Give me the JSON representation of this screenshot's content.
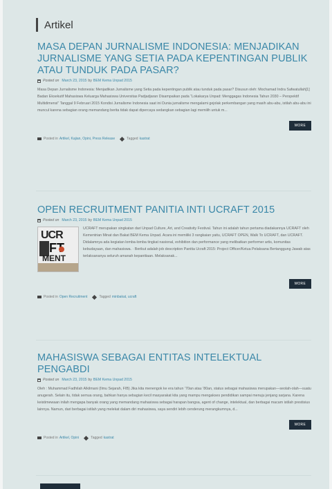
{
  "section": {
    "title": "Artikel"
  },
  "labels": {
    "posted_on": "Posted on",
    "by": "by",
    "posted_in": "Posted in",
    "tagged": "Tagged",
    "more": "MORE"
  },
  "posts": [
    {
      "title": "MASA DEPAN JURNALISME INDONESIA: MENJADIKAN JURNALISME YANG SETIA PADA KEPENTINGAN PUBLIK ATAU TUNDUK PADA PASAR?",
      "date": "March 23, 2015",
      "author": "BEM Kema Unpad 2015",
      "excerpt": "Masa Depan Jurnalisme Indonesia: Menjadikan Jurnalisme yang Setia pada kepentingan publik atau tunduk pada pasar? Disusun oleh: Mochamad Indra Safwatullah[1] Badan Eksekutif Mahasiswa Keluarga Mahasiswa Universitas Padjadjaran Disampaikan pada “Lokakarya Unpad: Menggagas Indonesia Tahun 2030 – Perspektif Multidimensi” Tanggal 9 Februari 2015 Kondisi Jurnalisme Indonesia saat ini Dunia jurnalisme mengalami gejolak perkembangan yang masih abu-abu, istilah abu-abu ini muncul karena sebagian orang memandang berita tidak dapat dipercaya sedangkan sebagian lagi memilih untuk m...",
      "categories": "Artikel, Kajian, Opini, Press Release",
      "tags": "kastrat"
    },
    {
      "title": "OPEN RECRUITMENT PANITIA INTI UCRAFT 2015",
      "date": "March 23, 2015",
      "author": "BEM Kema Unpad 2015",
      "thumb": {
        "top": "UCR",
        "mid": "FT",
        "bot": "MENT"
      },
      "excerpt": "UCRAFT merupakan singkatan dari Unpad Culture, Art, and Creativity Festival. Tahun ini adalah tahun pertama diadakannya UCRAFT oleh Kementrian Minat dan Bakat BEM Kema Unpad. Acara ini memiliki 3 rangkaian yaitu, UCRAFT OPEN, Walk To UCRAFT, dan UCRAFT. Didalamnya ada kegiatan lomba-lomba tingkat nasional, exhibition dan performance yang melibatkan performer artis, komunitas kebudayaan, dan mahasiswa. · Berikut adalah job description Panitia Ucraft 2015: Project Officer/Ketua Pelaksana Bertanggung Jawab atas terlaksananya seluruh amanah kepanitiaan. Melaksanak...",
      "categories": "Open Recruitment",
      "tags": "minbakat, ucraft"
    },
    {
      "title": "MAHASISWA SEBAGAI ENTITAS INTELEKTUAL PENGABDI",
      "date": "March 23, 2015",
      "author": "BEM Kema Unpad 2015",
      "excerpt": "Oleh : Muhammad Fadhilah Alkilmani (Ilmu Sejarah, FIB) Jika kita menengok ke era tahun ’70an atau ’80an, status sebagai mahasiswa merupakan—seolah-olah—suatu anugerah. Selain itu, tidak semua orang, bahkan hanya sebagian kecil masyarakat kita yang mampu mengakses pendidikan sampai menuju jenjang sarjana. Karena keistimewaan inilah mengapa banyak orang yang memandang mahasiswa sebagai harapan bangsa, agent of change, intelektual, dan berbagai macam istilah prestisius lainnya. Namun, dari berbagai istilah yang melekat dalam diri mahasiswa, saya sendiri lebih cenderung merangkumnya, d...",
      "categories": "Artikel, Opini",
      "tags": "kastrat"
    }
  ]
}
